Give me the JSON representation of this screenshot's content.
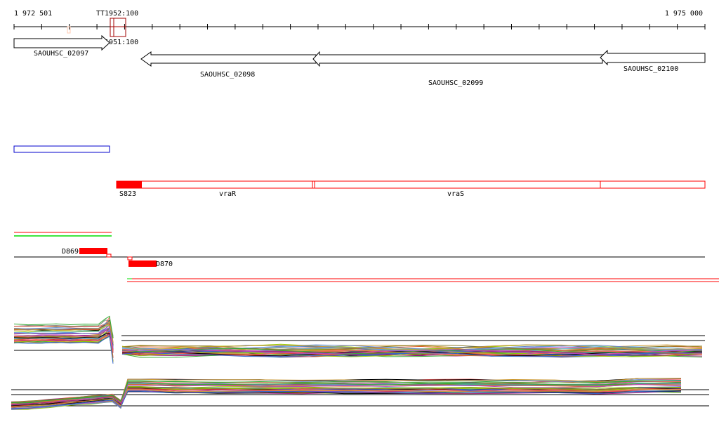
{
  "ruler": {
    "start_label": "1 972 501",
    "end_label": "1 975 000",
    "marker_label_top": "TT1952:100",
    "marker_label_bottom": "TT1951:100"
  },
  "genes": [
    {
      "label": "SAOUHSC_02097",
      "strand": "+"
    },
    {
      "label": "SAOUHSC_02098",
      "strand": "-"
    },
    {
      "label": "SAOUHSC_02099",
      "strand": "-"
    },
    {
      "label": "SAOUHSC_02100",
      "strand": "-"
    }
  ],
  "operon": {
    "start_label": "S823",
    "genes": [
      "vraR",
      "vraS"
    ]
  },
  "transcripts": [
    {
      "label": "D869"
    },
    {
      "label": "D870"
    }
  ],
  "colors": {
    "feature_red": "#ff0000",
    "marker_dark_red": "#a00000",
    "box_blue": "#0000cc",
    "green": "#00dd00",
    "expression_palette": [
      "#e0662a",
      "#66b3e6",
      "#a02080",
      "#99cc00",
      "#8b7d2a",
      "#000000",
      "#ff6666",
      "#6688cc",
      "#cc9933",
      "#33aa33",
      "#bb44bb",
      "#3366cc",
      "#cc3333",
      "#888888"
    ]
  }
}
